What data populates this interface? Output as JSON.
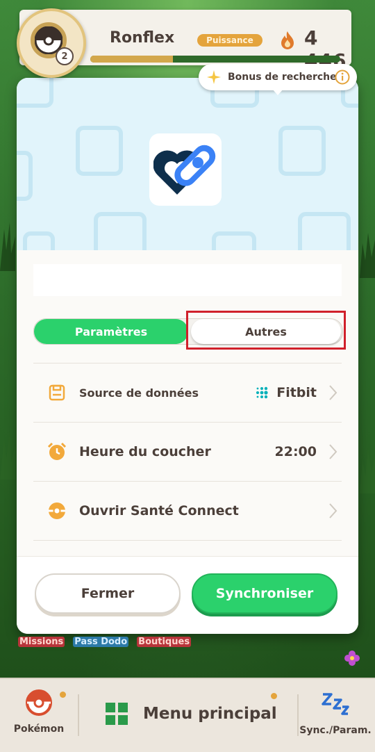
{
  "top_bar": {
    "level_badge": "2",
    "pokemon_name": "Ronflex",
    "power_tag": "Puissance",
    "power_value": "4446",
    "progress_fraction": 0.33
  },
  "bonus": {
    "label": "Bonus de recherche",
    "info_icon": "info-icon"
  },
  "modal": {
    "app_icon": "health-connect-icon",
    "tabs": [
      {
        "label": "Paramètres",
        "active": true
      },
      {
        "label": "Autres",
        "active": false
      }
    ],
    "rows": [
      {
        "icon": "save-icon",
        "label": "Source de données",
        "value": "Fitbit",
        "value_icon": "fitbit-icon"
      },
      {
        "icon": "alarm-clock-icon",
        "label": "Heure du coucher",
        "value": "22:00"
      },
      {
        "icon": "health-connect-open-icon",
        "label": "Ouvrir Santé Connect",
        "value": ""
      }
    ],
    "buttons": {
      "close": "Fermer",
      "sync": "Synchroniser"
    }
  },
  "side_labels": [
    "Missions",
    "Pass Dodo",
    "Boutiques"
  ],
  "bottom_nav": {
    "pokemon": "Pokémon",
    "main_menu": "Menu principal",
    "sync": "Sync./Param."
  },
  "colors": {
    "accent_green": "#2bd16c",
    "highlight_red": "#d0202b",
    "text_brown": "#4b3f39"
  }
}
